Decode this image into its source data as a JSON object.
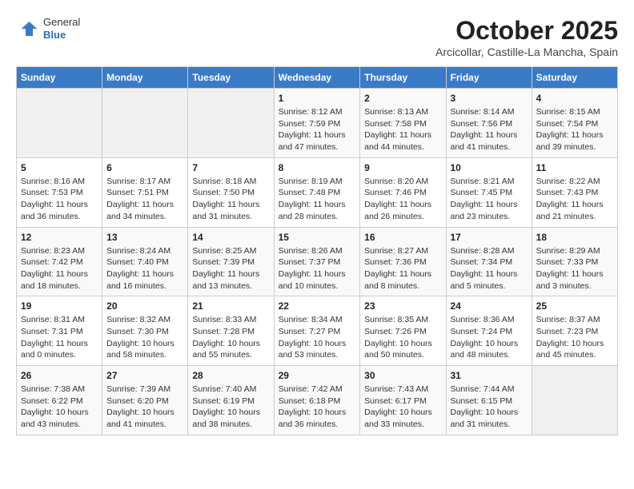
{
  "header": {
    "logo_line1": "General",
    "logo_line2": "Blue",
    "month": "October 2025",
    "location": "Arcicollar, Castille-La Mancha, Spain"
  },
  "weekdays": [
    "Sunday",
    "Monday",
    "Tuesday",
    "Wednesday",
    "Thursday",
    "Friday",
    "Saturday"
  ],
  "weeks": [
    [
      {
        "day": "",
        "info": ""
      },
      {
        "day": "",
        "info": ""
      },
      {
        "day": "",
        "info": ""
      },
      {
        "day": "1",
        "info": "Sunrise: 8:12 AM\nSunset: 7:59 PM\nDaylight: 11 hours\nand 47 minutes."
      },
      {
        "day": "2",
        "info": "Sunrise: 8:13 AM\nSunset: 7:58 PM\nDaylight: 11 hours\nand 44 minutes."
      },
      {
        "day": "3",
        "info": "Sunrise: 8:14 AM\nSunset: 7:56 PM\nDaylight: 11 hours\nand 41 minutes."
      },
      {
        "day": "4",
        "info": "Sunrise: 8:15 AM\nSunset: 7:54 PM\nDaylight: 11 hours\nand 39 minutes."
      }
    ],
    [
      {
        "day": "5",
        "info": "Sunrise: 8:16 AM\nSunset: 7:53 PM\nDaylight: 11 hours\nand 36 minutes."
      },
      {
        "day": "6",
        "info": "Sunrise: 8:17 AM\nSunset: 7:51 PM\nDaylight: 11 hours\nand 34 minutes."
      },
      {
        "day": "7",
        "info": "Sunrise: 8:18 AM\nSunset: 7:50 PM\nDaylight: 11 hours\nand 31 minutes."
      },
      {
        "day": "8",
        "info": "Sunrise: 8:19 AM\nSunset: 7:48 PM\nDaylight: 11 hours\nand 28 minutes."
      },
      {
        "day": "9",
        "info": "Sunrise: 8:20 AM\nSunset: 7:46 PM\nDaylight: 11 hours\nand 26 minutes."
      },
      {
        "day": "10",
        "info": "Sunrise: 8:21 AM\nSunset: 7:45 PM\nDaylight: 11 hours\nand 23 minutes."
      },
      {
        "day": "11",
        "info": "Sunrise: 8:22 AM\nSunset: 7:43 PM\nDaylight: 11 hours\nand 21 minutes."
      }
    ],
    [
      {
        "day": "12",
        "info": "Sunrise: 8:23 AM\nSunset: 7:42 PM\nDaylight: 11 hours\nand 18 minutes."
      },
      {
        "day": "13",
        "info": "Sunrise: 8:24 AM\nSunset: 7:40 PM\nDaylight: 11 hours\nand 16 minutes."
      },
      {
        "day": "14",
        "info": "Sunrise: 8:25 AM\nSunset: 7:39 PM\nDaylight: 11 hours\nand 13 minutes."
      },
      {
        "day": "15",
        "info": "Sunrise: 8:26 AM\nSunset: 7:37 PM\nDaylight: 11 hours\nand 10 minutes."
      },
      {
        "day": "16",
        "info": "Sunrise: 8:27 AM\nSunset: 7:36 PM\nDaylight: 11 hours\nand 8 minutes."
      },
      {
        "day": "17",
        "info": "Sunrise: 8:28 AM\nSunset: 7:34 PM\nDaylight: 11 hours\nand 5 minutes."
      },
      {
        "day": "18",
        "info": "Sunrise: 8:29 AM\nSunset: 7:33 PM\nDaylight: 11 hours\nand 3 minutes."
      }
    ],
    [
      {
        "day": "19",
        "info": "Sunrise: 8:31 AM\nSunset: 7:31 PM\nDaylight: 11 hours\nand 0 minutes."
      },
      {
        "day": "20",
        "info": "Sunrise: 8:32 AM\nSunset: 7:30 PM\nDaylight: 10 hours\nand 58 minutes."
      },
      {
        "day": "21",
        "info": "Sunrise: 8:33 AM\nSunset: 7:28 PM\nDaylight: 10 hours\nand 55 minutes."
      },
      {
        "day": "22",
        "info": "Sunrise: 8:34 AM\nSunset: 7:27 PM\nDaylight: 10 hours\nand 53 minutes."
      },
      {
        "day": "23",
        "info": "Sunrise: 8:35 AM\nSunset: 7:26 PM\nDaylight: 10 hours\nand 50 minutes."
      },
      {
        "day": "24",
        "info": "Sunrise: 8:36 AM\nSunset: 7:24 PM\nDaylight: 10 hours\nand 48 minutes."
      },
      {
        "day": "25",
        "info": "Sunrise: 8:37 AM\nSunset: 7:23 PM\nDaylight: 10 hours\nand 45 minutes."
      }
    ],
    [
      {
        "day": "26",
        "info": "Sunrise: 7:38 AM\nSunset: 6:22 PM\nDaylight: 10 hours\nand 43 minutes."
      },
      {
        "day": "27",
        "info": "Sunrise: 7:39 AM\nSunset: 6:20 PM\nDaylight: 10 hours\nand 41 minutes."
      },
      {
        "day": "28",
        "info": "Sunrise: 7:40 AM\nSunset: 6:19 PM\nDaylight: 10 hours\nand 38 minutes."
      },
      {
        "day": "29",
        "info": "Sunrise: 7:42 AM\nSunset: 6:18 PM\nDaylight: 10 hours\nand 36 minutes."
      },
      {
        "day": "30",
        "info": "Sunrise: 7:43 AM\nSunset: 6:17 PM\nDaylight: 10 hours\nand 33 minutes."
      },
      {
        "day": "31",
        "info": "Sunrise: 7:44 AM\nSunset: 6:15 PM\nDaylight: 10 hours\nand 31 minutes."
      },
      {
        "day": "",
        "info": ""
      }
    ]
  ]
}
